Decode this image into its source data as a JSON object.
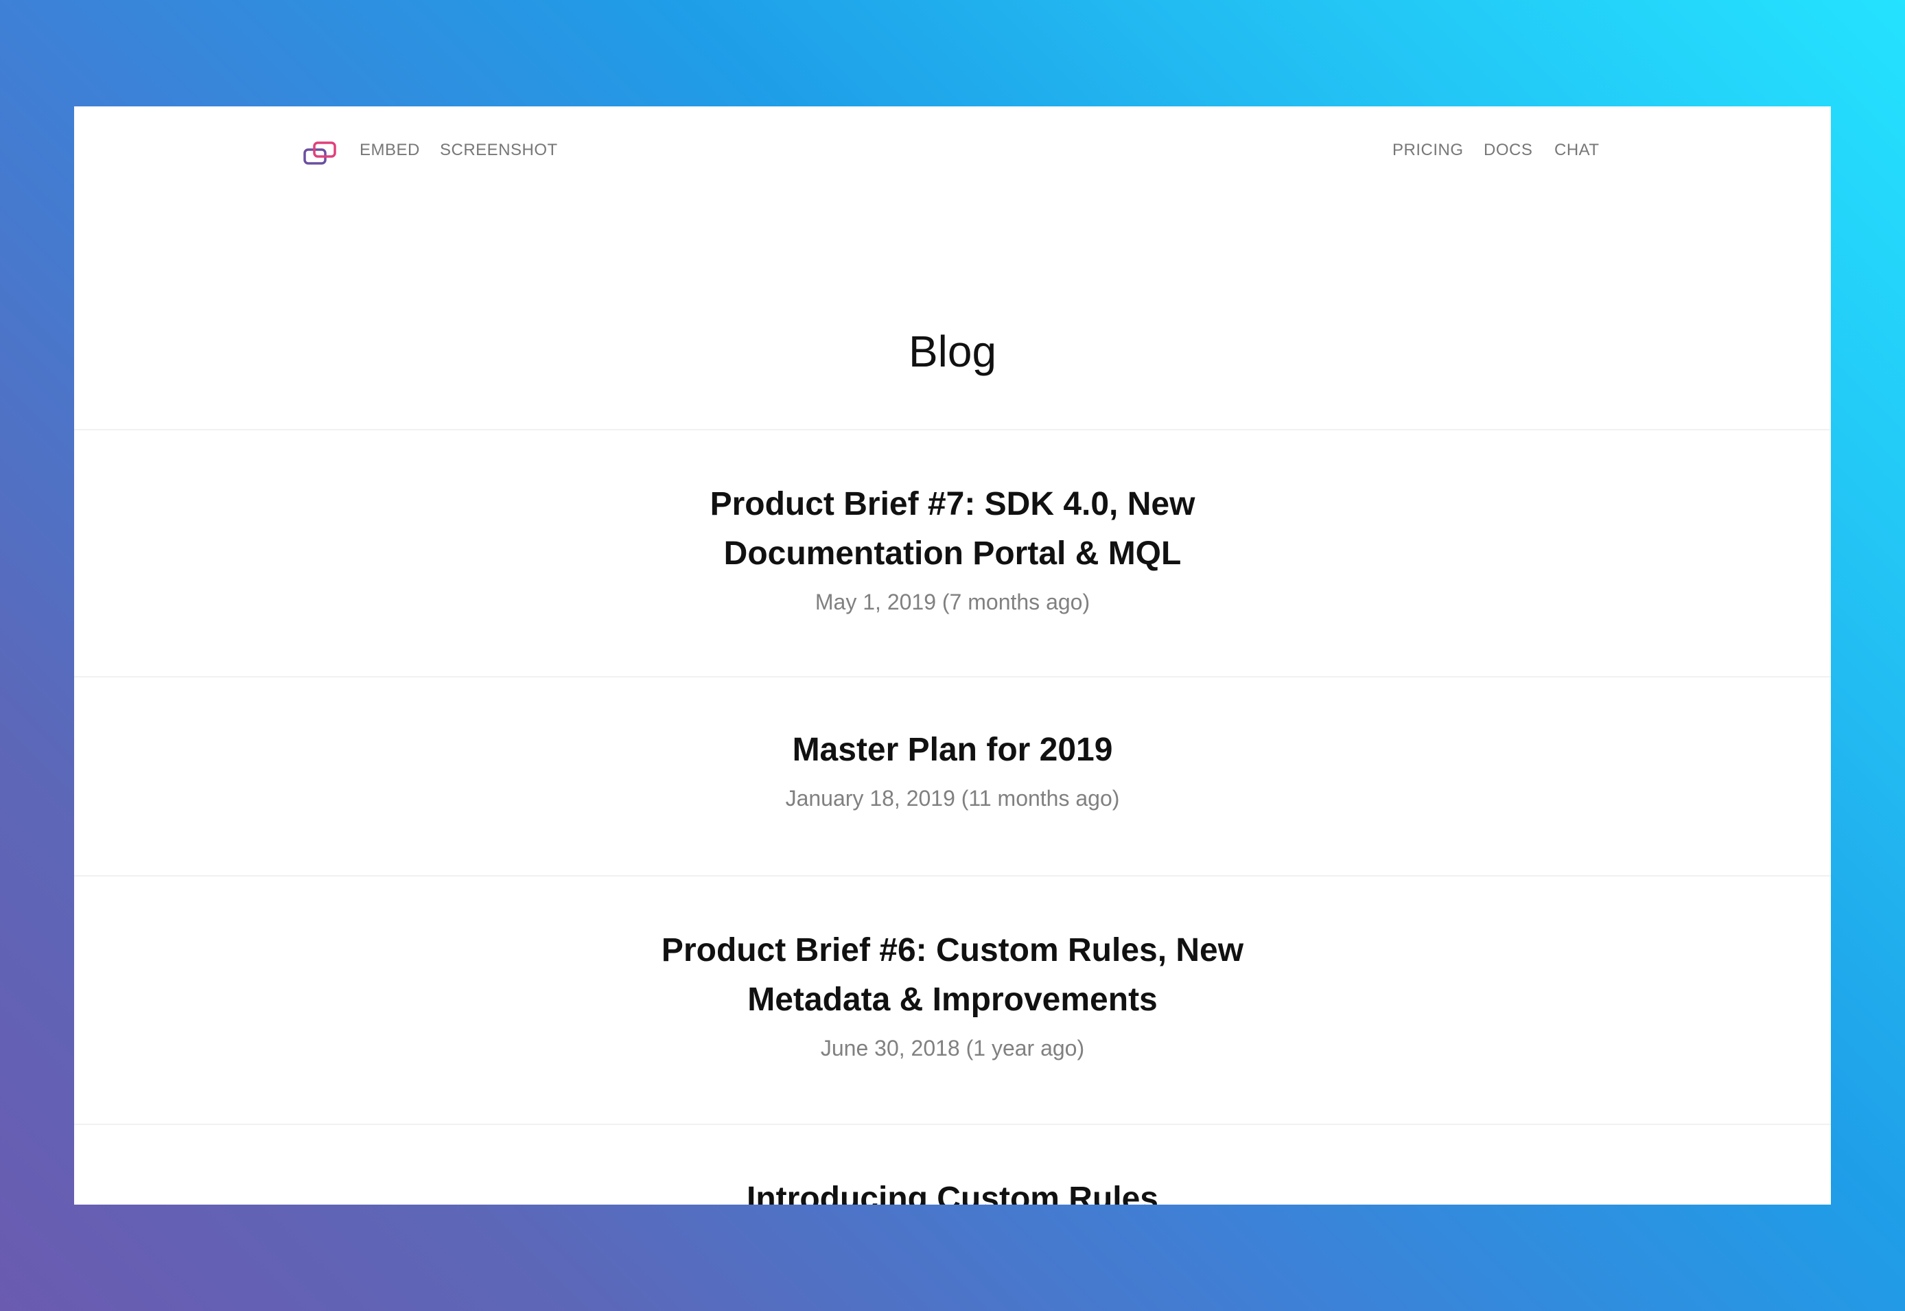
{
  "nav": {
    "logo_icon": "linked-rectangles-logo-icon",
    "left_links": [
      "EMBED",
      "SCREENSHOT"
    ],
    "right_links": [
      "PRICING",
      "DOCS",
      "CHAT"
    ]
  },
  "page": {
    "title": "Blog"
  },
  "posts": [
    {
      "title": "Product Brief #7: SDK 4.0, New Documentation Portal & MQL",
      "date": "May 1, 2019 (7 months ago)"
    },
    {
      "title": "Master Plan for 2019",
      "date": "January 18, 2019 (11 months ago)"
    },
    {
      "title": "Product Brief #6: Custom Rules, New Metadata & Improvements",
      "date": "June 30, 2018 (1 year ago)"
    },
    {
      "title": "Introducing Custom Rules",
      "date": ""
    }
  ],
  "colors": {
    "logo_pink": "#e0407a",
    "logo_purple": "#6b4fa0",
    "nav_text": "#777777",
    "title_text": "#111111",
    "date_text": "#808080"
  }
}
